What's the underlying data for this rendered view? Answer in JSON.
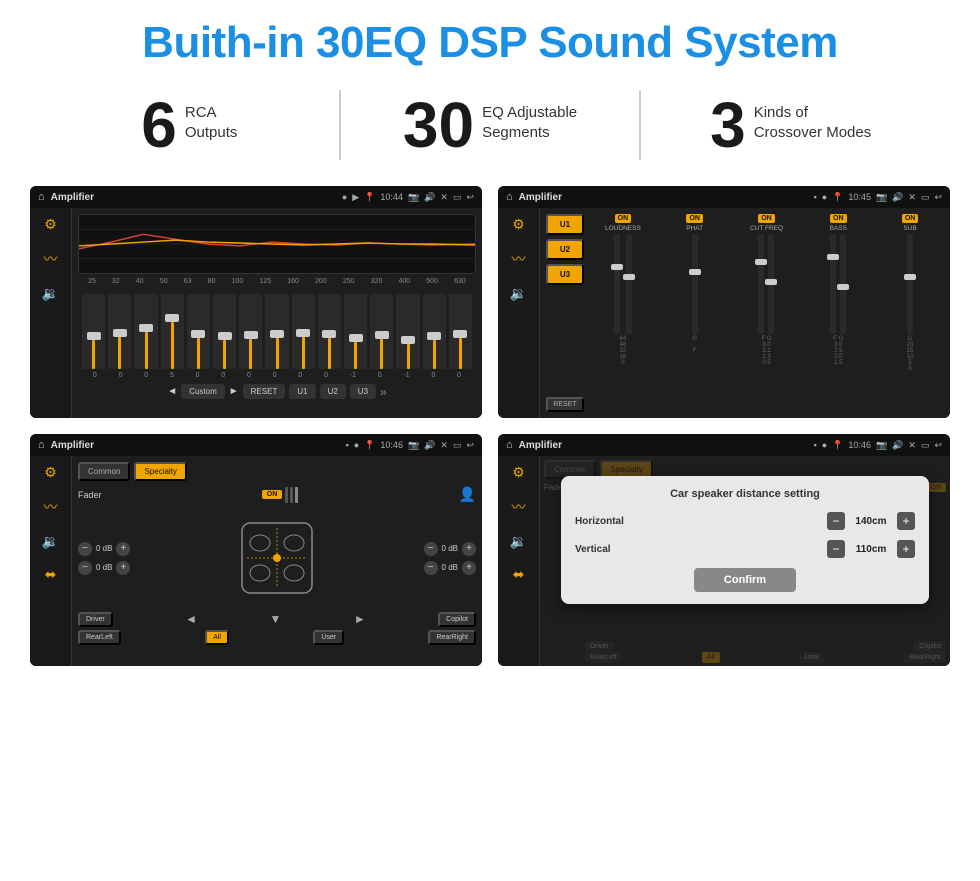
{
  "header": {
    "title": "Buith-in 30EQ DSP Sound System"
  },
  "stats": [
    {
      "number": "6",
      "label_line1": "RCA",
      "label_line2": "Outputs"
    },
    {
      "number": "30",
      "label_line1": "EQ Adjustable",
      "label_line2": "Segments"
    },
    {
      "number": "3",
      "label_line1": "Kinds of",
      "label_line2": "Crossover Modes"
    }
  ],
  "screens": {
    "eq": {
      "topbar_title": "Amplifier",
      "topbar_time": "10:44",
      "freq_labels": [
        "25",
        "32",
        "40",
        "50",
        "63",
        "80",
        "100",
        "125",
        "160",
        "200",
        "250",
        "320",
        "400",
        "500",
        "630"
      ],
      "values": [
        "0",
        "0",
        "0",
        "5",
        "0",
        "0",
        "0",
        "0",
        "0",
        "0",
        "-1",
        "0",
        "-1"
      ],
      "custom_label": "Custom",
      "reset_label": "RESET",
      "u1_label": "U1",
      "u2_label": "U2",
      "u3_label": "U3"
    },
    "crossover": {
      "topbar_title": "Amplifier",
      "topbar_time": "10:45",
      "presets": [
        "U1",
        "U2",
        "U3"
      ],
      "channels": [
        {
          "name": "LOUDNESS",
          "on": true
        },
        {
          "name": "PHAT",
          "on": true
        },
        {
          "name": "CUT FREQ",
          "on": true
        },
        {
          "name": "BASS",
          "on": true
        },
        {
          "name": "SUB",
          "on": true
        }
      ],
      "reset_label": "RESET"
    },
    "fader": {
      "topbar_title": "Amplifier",
      "topbar_time": "10:46",
      "tabs": [
        "Common",
        "Specialty"
      ],
      "active_tab": "Specialty",
      "fader_label": "Fader",
      "fader_on": "ON",
      "driver_label": "Driver",
      "copilot_label": "Copilot",
      "rear_left_label": "RearLeft",
      "all_label": "All",
      "user_label": "User",
      "rear_right_label": "RearRight",
      "db_values": [
        "0 dB",
        "0 dB",
        "0 dB",
        "0 dB"
      ]
    },
    "dialog": {
      "topbar_title": "Amplifier",
      "topbar_time": "10:46",
      "tabs": [
        "Common",
        "Specialty"
      ],
      "dialog_title": "Car speaker distance setting",
      "horizontal_label": "Horizontal",
      "horizontal_value": "140cm",
      "vertical_label": "Vertical",
      "vertical_value": "110cm",
      "confirm_label": "Confirm",
      "driver_label": "Driver",
      "copilot_label": "Copilot",
      "rear_left_label": "RearLeft",
      "user_label": "User",
      "rear_right_label": "RearRight"
    }
  }
}
